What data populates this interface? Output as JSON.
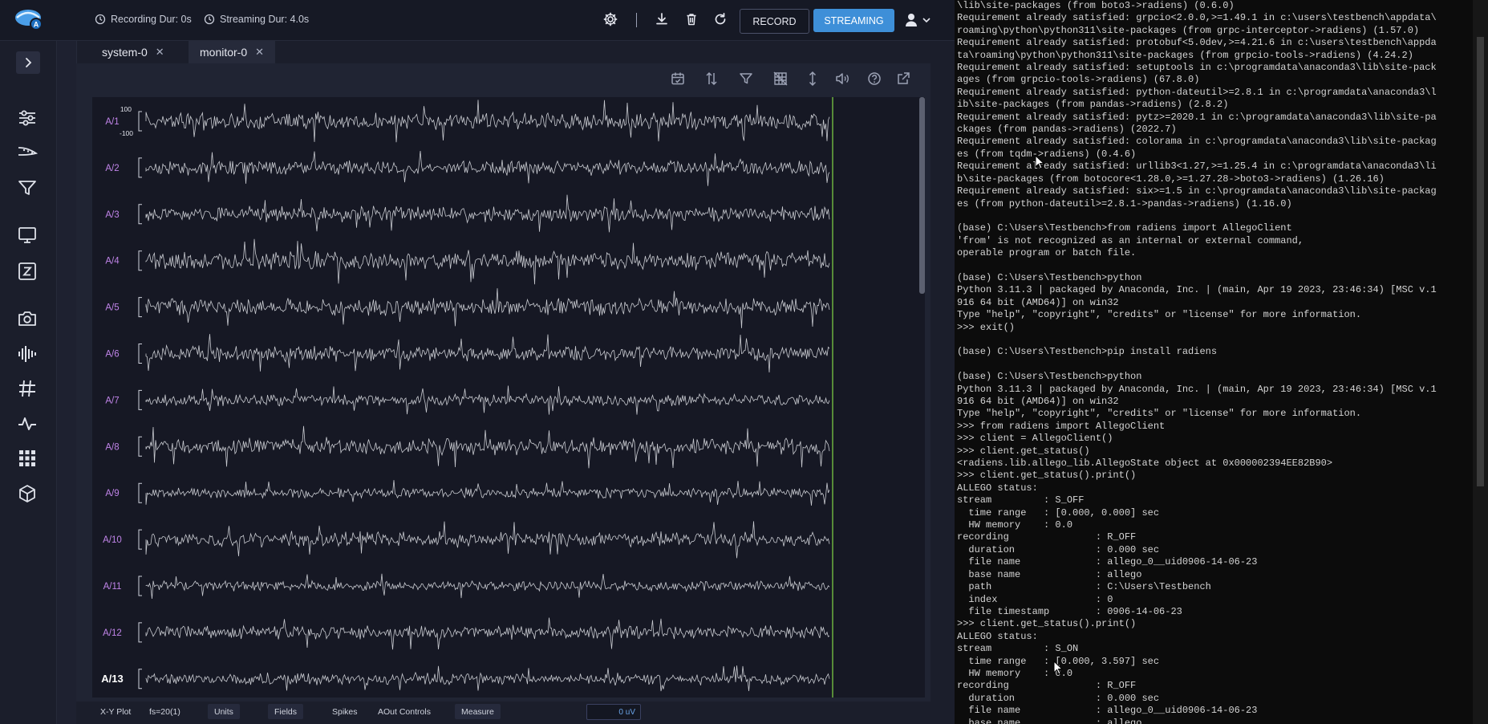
{
  "topbar": {
    "recording_duration": "Recording Dur: 0s",
    "streaming_duration": "Streaming Dur: 4.0s",
    "record_label": "RECORD",
    "streaming_label": "STREAMING",
    "icons": [
      "settings-icon",
      "download-icon",
      "trash-icon",
      "refresh-icon",
      "user-icon",
      "chevron-down-icon"
    ],
    "colors": {
      "accent": "#3e8fd8"
    }
  },
  "sidebar": {
    "items": [
      {
        "icon": "sliders-icon"
      },
      {
        "icon": "probe-icon"
      },
      {
        "icon": "filter-icon"
      },
      {
        "icon": "monitor-icon"
      },
      {
        "icon": "z-box-icon"
      },
      {
        "icon": "camera-icon"
      },
      {
        "icon": "waveform-icon"
      },
      {
        "icon": "hash-icon"
      },
      {
        "icon": "pulse-icon"
      },
      {
        "icon": "grid-icon"
      },
      {
        "icon": "cube-icon"
      }
    ]
  },
  "tabs": [
    {
      "label": "system-0"
    },
    {
      "label": "monitor-0"
    }
  ],
  "plot_toolbar": [
    "calendar-icon",
    "sort-icon",
    "filter-icon",
    "grid-off-icon",
    "vertical-expand-icon",
    "speaker-icon",
    "help-icon",
    "external-link-icon"
  ],
  "plot": {
    "scale_top": "100",
    "scale_bottom": "-100",
    "channels": [
      "A/1",
      "A/2",
      "A/3",
      "A/4",
      "A/5",
      "A/6",
      "A/7",
      "A/8",
      "A/9",
      "A/10",
      "A/11",
      "A/12",
      "A/13"
    ],
    "selected_channel": "A/13",
    "colors": {
      "channel_label": "#c084e8",
      "selected_label": "#ffffff",
      "trace": "#d8dae0",
      "cursor_line": "#7ac943"
    }
  },
  "bottombar": {
    "xy_plot": "X-Y Plot",
    "fs": "fs=20(1)",
    "units": "Units",
    "fields": "Fields",
    "spikes": "Spikes",
    "aout_controls": "AOut Controls",
    "measure": "Measure",
    "measure_value": "0 uV"
  },
  "terminal": {
    "lines": [
      "\\lib\\site-packages (from boto3->radiens) (0.6.0)",
      "Requirement already satisfied: grpcio<2.0.0,>=1.49.1 in c:\\users\\testbench\\appdata\\",
      "roaming\\python\\python311\\site-packages (from grpc-interceptor->radiens) (1.57.0)",
      "Requirement already satisfied: protobuf<5.0dev,>=4.21.6 in c:\\users\\testbench\\appda",
      "ta\\roaming\\python\\python311\\site-packages (from grpcio-tools->radiens) (4.24.2)",
      "Requirement already satisfied: setuptools in c:\\programdata\\anaconda3\\lib\\site-pack",
      "ages (from grpcio-tools->radiens) (67.8.0)",
      "Requirement already satisfied: python-dateutil>=2.8.1 in c:\\programdata\\anaconda3\\l",
      "ib\\site-packages (from pandas->radiens) (2.8.2)",
      "Requirement already satisfied: pytz>=2020.1 in c:\\programdata\\anaconda3\\lib\\site-pa",
      "ckages (from pandas->radiens) (2022.7)",
      "Requirement already satisfied: colorama in c:\\programdata\\anaconda3\\lib\\site-packag",
      "es (from tqdm->radiens) (0.4.6)",
      "Requirement already satisfied: urllib3<1.27,>=1.25.4 in c:\\programdata\\anaconda3\\li",
      "b\\site-packages (from botocore<1.28.0,>=1.27.28->boto3->radiens) (1.26.16)",
      "Requirement already satisfied: six>=1.5 in c:\\programdata\\anaconda3\\lib\\site-packag",
      "es (from python-dateutil>=2.8.1->pandas->radiens) (1.16.0)",
      "",
      "(base) C:\\Users\\Testbench>from radiens import AllegoClient",
      "'from' is not recognized as an internal or external command,",
      "operable program or batch file.",
      "",
      "(base) C:\\Users\\Testbench>python",
      "Python 3.11.3 | packaged by Anaconda, Inc. | (main, Apr 19 2023, 23:46:34) [MSC v.1",
      "916 64 bit (AMD64)] on win32",
      "Type \"help\", \"copyright\", \"credits\" or \"license\" for more information.",
      ">>> exit()",
      "",
      "(base) C:\\Users\\Testbench>pip install radiens",
      "",
      "(base) C:\\Users\\Testbench>python",
      "Python 3.11.3 | packaged by Anaconda, Inc. | (main, Apr 19 2023, 23:46:34) [MSC v.1",
      "916 64 bit (AMD64)] on win32",
      "Type \"help\", \"copyright\", \"credits\" or \"license\" for more information.",
      ">>> from radiens import AllegoClient",
      ">>> client = AllegoClient()",
      ">>> client.get_status()",
      "<radiens.lib.allego_lib.AllegoState object at 0x000002394EE82B90>",
      ">>> client.get_status().print()",
      "ALLEGO status:",
      "stream         : S_OFF",
      "  time range   : [0.000, 0.000] sec",
      "  HW memory    : 0.0",
      "recording               : R_OFF",
      "  duration              : 0.000 sec",
      "  file name             : allego_0__uid0906-14-06-23",
      "  base name             : allego",
      "  path                  : C:\\Users\\Testbench",
      "  index                 : 0",
      "  file timestamp        : 0906-14-06-23",
      ">>> client.get_status().print()",
      "ALLEGO status:",
      "stream         : S_ON",
      "  time range   : [0.000, 3.597] sec",
      "  HW memory    : 0.0",
      "recording               : R_OFF",
      "  duration              : 0.000 sec",
      "  file name             : allego_0__uid0906-14-06-23",
      "  base name             : allego"
    ]
  }
}
